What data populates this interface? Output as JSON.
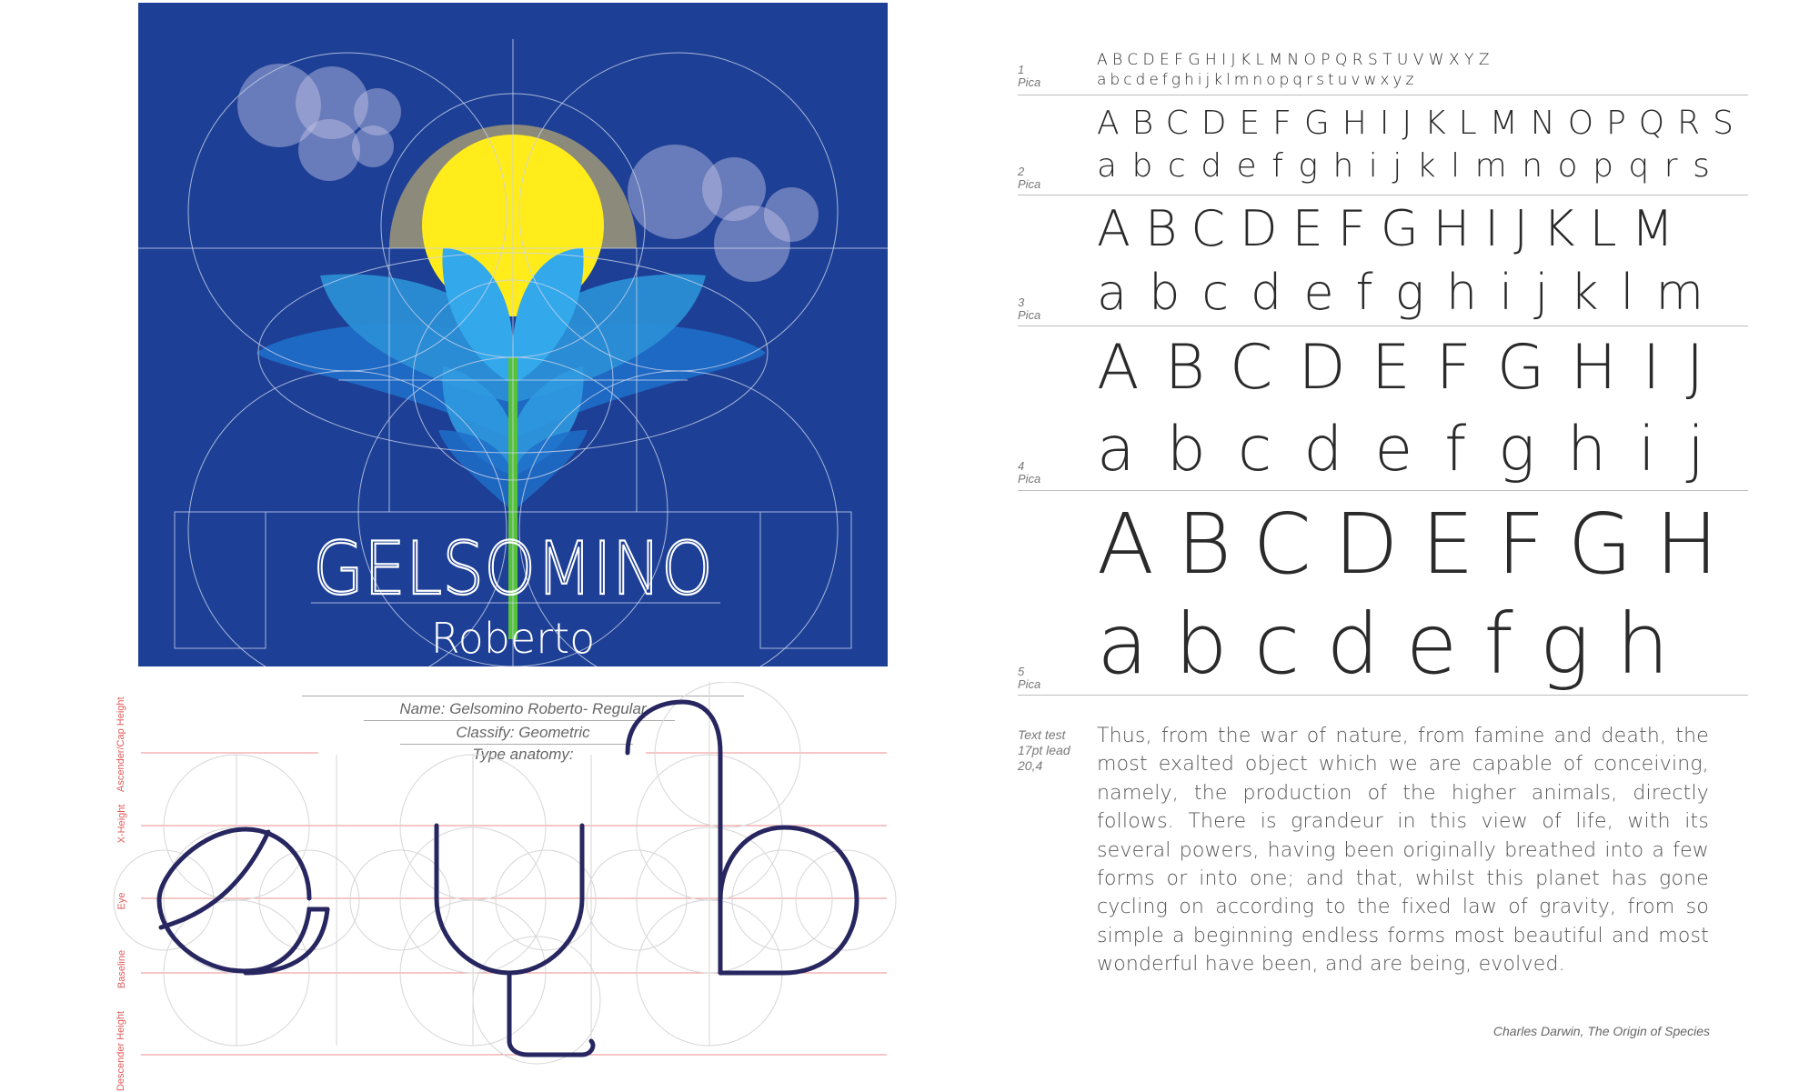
{
  "poster": {
    "title": "GELSOMINO",
    "subtitle": "Roberto",
    "colors": {
      "background": "#1d3f95",
      "sun": "#ffec1a",
      "sun_halo": "#8c8a7a",
      "petal": "#2a8fd6",
      "stem": "#55c23a"
    }
  },
  "anatomy": {
    "name_line": "Name: Gelsomino Roberto- Regular",
    "classify_line": "Classify: Geometric",
    "type_line": "Type anatomy:",
    "labels": {
      "ascender": "Ascender/Cap Height",
      "xheight": "X-Height",
      "eye": "Eye",
      "baseline": "Baseline",
      "descender": "Descender Height"
    },
    "glyph_color": "#272660",
    "guide_color": "#e05a5a"
  },
  "specimen": {
    "rows": [
      {
        "label_num": "1",
        "label_unit": "Pica",
        "upper": "ABCDEFGHIJKLMNOPQRSTUVWXYZ",
        "lower": "abcdefghijklmnopqrstuvwxyz"
      },
      {
        "label_num": "2",
        "label_unit": "Pica",
        "upper": "ABCDEFGHIJKLMNOPQRS",
        "lower": "abcdefghijklmnopqrs"
      },
      {
        "label_num": "3",
        "label_unit": "Pica",
        "upper": "ABCDEFGHIJKLM",
        "lower": "abcdefghijklm"
      },
      {
        "label_num": "4",
        "label_unit": "Pica",
        "upper": "ABCDEFGHIJ",
        "lower": "abcdefghij"
      },
      {
        "label_num": "5",
        "label_unit": "Pica",
        "upper": "ABCDEFGH",
        "lower": "abcdefgh"
      }
    ],
    "text_test_label": "Text test 17pt lead 20,4",
    "text_test": "Thus, from the war of nature, from famine and death, the most exalted object which we are capable of conceiving, namely, the production of the higher animals, directly follows. There is grandeur in this view of life, with its several powers, having been originally breathed into a few forms or into one; and that, whilst this planet has gone cycling on according to the fixed law of gravity, from so simple a beginning endless forms most beautiful and most wonderful have been, and are being, evolved.",
    "attribution": "Charles Darwin, The Origin of Species"
  }
}
